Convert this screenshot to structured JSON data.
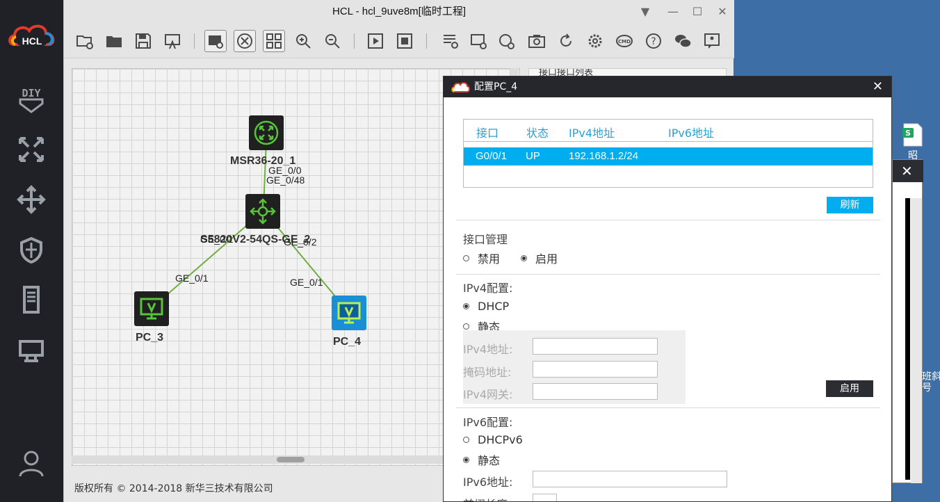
{
  "main_window": {
    "title": "HCL - hcl_9uve8m[临时工程]",
    "footer": "版权所有 © 2014-2018 新华三技术有限公司",
    "side_panel_title": "接口接口列表"
  },
  "topology": {
    "nodes": [
      {
        "name": "MSR36-20_1"
      },
      {
        "name": "S5820V2-54QS-GE_2"
      },
      {
        "name": "PC_3"
      },
      {
        "name": "PC_4"
      }
    ],
    "ports": {
      "router_down": "GE_0/0",
      "switch_up": "GE_0/48",
      "switch_left": "GE_0/1",
      "switch_right": "GE_0/2",
      "pc3": "GE_0/1",
      "pc4": "GE_0/1"
    }
  },
  "dialog": {
    "title": "配置PC_4",
    "table": {
      "headers": [
        "接口",
        "状态",
        "IPv4地址",
        "IPv6地址"
      ],
      "rows": [
        {
          "iface": "G0/0/1",
          "status": "UP",
          "ipv4": "192.168.1.2/24",
          "ipv6": ""
        }
      ]
    },
    "refresh_button": "刷新",
    "iface_mgmt": {
      "title": "接口管理",
      "disable": "禁用",
      "enable": "启用",
      "selected": "启用"
    },
    "ipv4": {
      "title": "IPv4配置:",
      "dhcp": "DHCP",
      "static": "静态",
      "selected": "DHCP",
      "addr_label": "IPv4地址:",
      "mask_label": "掩码地址:",
      "gw_label": "IPv4网关:",
      "addr_value": "",
      "mask_value": "",
      "gw_value": "",
      "apply_button": "启用"
    },
    "ipv6": {
      "title": "IPv6配置:",
      "dhcp": "DHCPv6",
      "static": "静态",
      "selected": "静态",
      "addr_label": "IPv6地址:",
      "prefix_label": "前缀长度",
      "addr_value": ""
    }
  },
  "desktop": {
    "icon_label": "昭",
    "text_1": "班斜",
    "text_2": "号"
  },
  "colors": {
    "accent": "#00aeef",
    "sidebar_bg": "#1f2126",
    "desktop_bg": "#3d6fa6",
    "link_green": "#6fae3f"
  }
}
